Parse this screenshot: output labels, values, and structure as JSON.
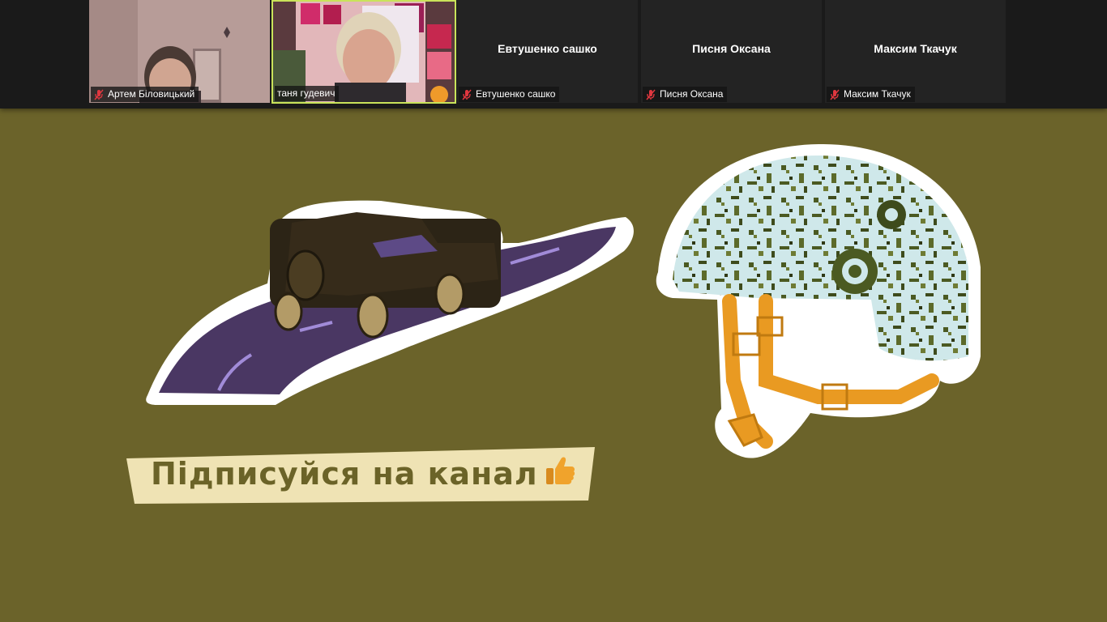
{
  "participants": [
    {
      "name": "Артем Біловицький",
      "video": true,
      "active": false,
      "muted": true
    },
    {
      "name": "таня гудевич",
      "video": true,
      "active": true,
      "muted": false
    },
    {
      "name": "Евтушенко сашко",
      "video": false,
      "active": false,
      "muted": true
    },
    {
      "name": "Писня Оксана",
      "video": false,
      "active": false,
      "muted": true
    },
    {
      "name": "Максим Ткачук",
      "video": false,
      "active": false,
      "muted": true
    }
  ],
  "shared_screen": {
    "banner_text": "Підписуйся на канал",
    "background_color": "#6b632a",
    "banner_color": "#efe3b4",
    "stickers": [
      "car-on-road-sticker",
      "embroidered-helmet-sticker",
      "thumbs-up-icon"
    ]
  },
  "colors": {
    "active_speaker_border": "#c9e35a",
    "muted_icon": "#e0373f"
  }
}
